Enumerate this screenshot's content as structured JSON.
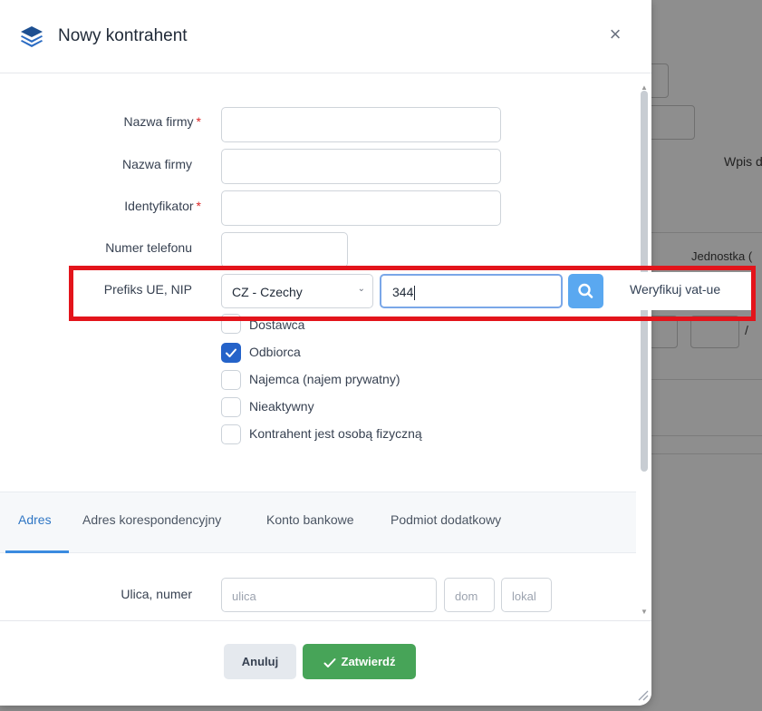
{
  "background": {
    "texts": [
      "Wpis d",
      "Jednostka (",
      "/"
    ]
  },
  "modal": {
    "title": "Nowy kontrahent",
    "close_icon": "close-icon",
    "logo_icon": "layers-icon"
  },
  "form": {
    "company_name_label": "Nazwa firmy",
    "company_name2_label": "Nazwa firmy",
    "identifier_label": "Identyfikator",
    "phone_label": "Numer telefonu",
    "prefix_nip_label": "Prefiks UE, NIP",
    "required_mark": "*",
    "country_select_value": "CZ - Czechy",
    "nip_value": "344",
    "verify_vat_label": "Weryfikuj vat-ue"
  },
  "checkboxes": [
    {
      "label": "Dostawca",
      "checked": false
    },
    {
      "label": "Odbiorca",
      "checked": true
    },
    {
      "label": "Najemca (najem prywatny)",
      "checked": false
    },
    {
      "label": "Nieaktywny",
      "checked": false
    },
    {
      "label": "Kontrahent jest osobą fizyczną",
      "checked": false
    }
  ],
  "tabs": [
    {
      "label": "Adres",
      "active": true
    },
    {
      "label": "Adres korespondencyjny",
      "active": false
    },
    {
      "label": "Konto bankowe",
      "active": false
    },
    {
      "label": "Podmiot dodatkowy",
      "active": false
    }
  ],
  "address": {
    "street_label": "Ulica, numer",
    "street_placeholder": "ulica",
    "house_placeholder": "dom",
    "apartment_placeholder": "lokal"
  },
  "footer": {
    "cancel_label": "Anuluj",
    "confirm_label": "Zatwierdź"
  },
  "colors": {
    "accent": "#2f76c4",
    "confirm": "#47a458",
    "highlight": "#e3141b",
    "search_button": "#5aa8f0"
  }
}
